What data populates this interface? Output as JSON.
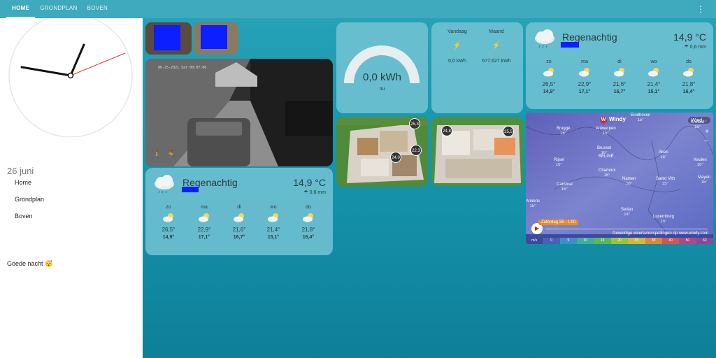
{
  "tabs": [
    {
      "label": "HOME"
    },
    {
      "label": "GRONDPLAN"
    },
    {
      "label": "BOVEN"
    }
  ],
  "sidebar": {
    "date": "26 juni",
    "nav": [
      {
        "label": "Home"
      },
      {
        "label": "Grondplan"
      },
      {
        "label": "Boven"
      }
    ],
    "message": "Goede nacht 😴"
  },
  "camera": {
    "timestamp": "06-25-2021 Sat 00:07:06"
  },
  "energy": {
    "value": "0,0 kWh",
    "caption": "nu",
    "gauge_fraction": 0.0
  },
  "energy_stats": {
    "headers": [
      "Vandaag",
      "Maand"
    ],
    "values": [
      "0,0 kWh",
      "677,627 kWh"
    ]
  },
  "weather": {
    "condition": "Regenachtig",
    "temperature": "14,9 °C",
    "precipitation": "0,6 mm",
    "forecast": [
      {
        "day": "zo",
        "high": "26,5°",
        "low": "14,9°"
      },
      {
        "day": "ma",
        "high": "22,9°",
        "low": "17,1°"
      },
      {
        "day": "di",
        "high": "21,6°",
        "low": "16,7°"
      },
      {
        "day": "wo",
        "high": "21,4°",
        "low": "15,1°"
      },
      {
        "day": "do",
        "high": "21,8°",
        "low": "16,4°"
      }
    ]
  },
  "floorplan_ground": {
    "badges": [
      "25,3",
      "22,3",
      "24,0"
    ]
  },
  "floorplan_upper": {
    "badges": [
      "24,8",
      "25,5"
    ]
  },
  "map": {
    "brand": "Windy",
    "layer": "Wind",
    "timeline_label": "Zaterdag 26 - 1:00",
    "footer": "Geweldige weersvoorspellingen op www.windy.com",
    "cities": [
      {
        "name": "Eindhoven",
        "temp": "15°"
      },
      {
        "name": "Brugge",
        "temp": "16°"
      },
      {
        "name": "Antwerpen",
        "temp": "15°"
      },
      {
        "name": "Krefeld",
        "temp": "16°"
      },
      {
        "name": "Brussel",
        "temp": "16°"
      },
      {
        "name": "Aken",
        "temp": "15°"
      },
      {
        "name": "Rijsel",
        "temp": "16°"
      },
      {
        "name": "Keulen",
        "temp": "16°"
      },
      {
        "name": "BELGIË",
        "temp": ""
      },
      {
        "name": "Charleroi",
        "temp": "16°"
      },
      {
        "name": "Cambrai",
        "temp": "16°"
      },
      {
        "name": "Namen",
        "temp": "16°"
      },
      {
        "name": "Sankt Vith",
        "temp": "15°"
      },
      {
        "name": "Mayen",
        "temp": "15°"
      },
      {
        "name": "Amiens",
        "temp": "15°"
      },
      {
        "name": "Sedan",
        "temp": "14°"
      },
      {
        "name": "Luxemburg",
        "temp": "15°"
      }
    ],
    "scale": [
      "m/s",
      "0",
      "5",
      "10",
      "15",
      "20",
      "25",
      "30",
      "40",
      "50",
      "60"
    ]
  },
  "colors": {
    "accent": "#3fa9bd",
    "card": "#73c3d4",
    "clock_second_hand": "#e53935"
  }
}
